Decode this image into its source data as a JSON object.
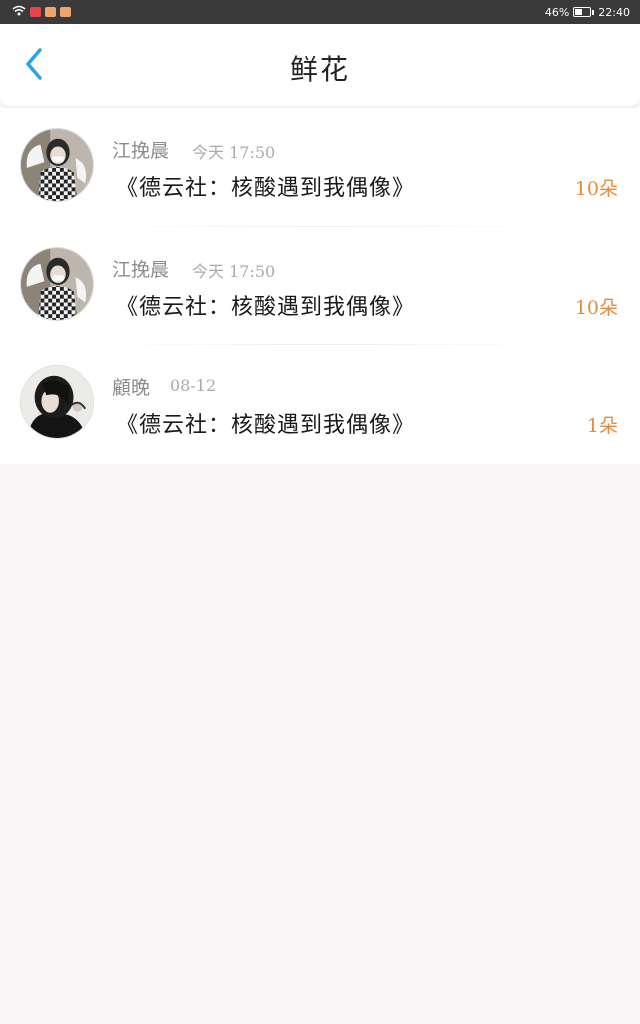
{
  "status_bar": {
    "battery": "46%",
    "battery_level": 0.46,
    "time": "22:40",
    "icons": [
      "wifi-icon",
      "app-notification-red-icon",
      "app-notification-orange-icon",
      "app-notification-orange-icon"
    ]
  },
  "header": {
    "title": "鲜花",
    "back_icon": "chevron-left-icon",
    "back_color": "#2aa3e6"
  },
  "flowers": [
    {
      "name": "江挽晨",
      "time": "今天 17:50",
      "message": "《德云社：核酸遇到我偶像》",
      "count": "10朵",
      "avatar": "avatar-checker"
    },
    {
      "name": "江挽晨",
      "time": "今天 17:50",
      "message": "《德云社：核酸遇到我偶像》",
      "count": "10朵",
      "avatar": "avatar-checker"
    },
    {
      "name": "顧晚",
      "time": "08-12",
      "message": "《德云社：核酸遇到我偶像》",
      "count": "1朵",
      "avatar": "avatar-dark-hair"
    }
  ],
  "colors": {
    "accent": "#2aa3e6",
    "count": "#e68a3c",
    "status_bar_bg": "#3a3a3a",
    "page_bg": "#f7f5f5"
  }
}
